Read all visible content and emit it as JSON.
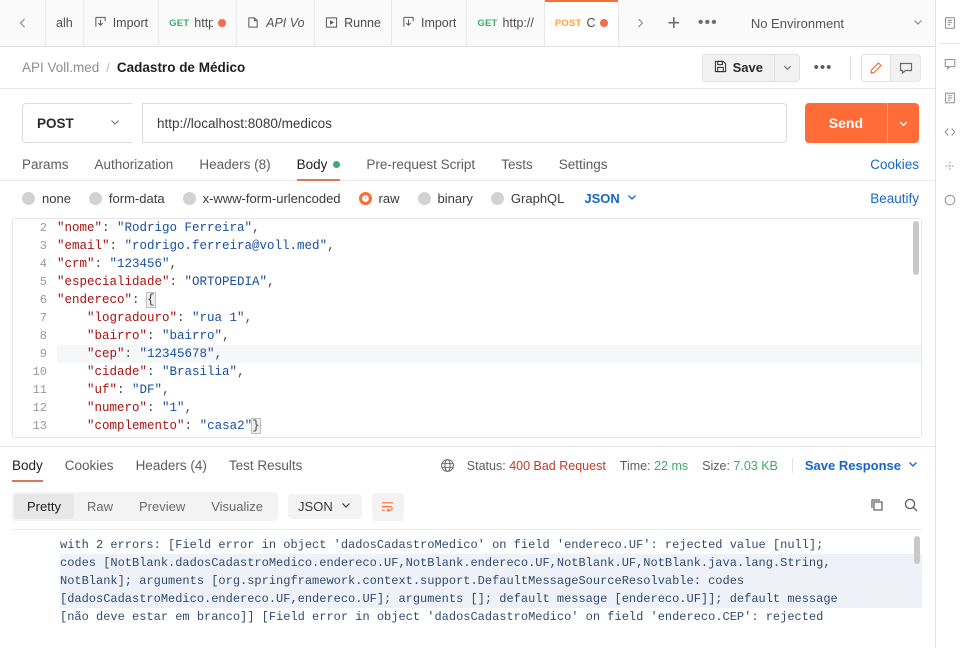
{
  "tabbar": {
    "nav_back": "chevron-left",
    "nav_forward": "chevron-right",
    "add_label": "+",
    "more_label": "•••",
    "environment": "No Environment",
    "tabs": [
      {
        "method": "",
        "label": "alh",
        "icon": "",
        "unsaved": false,
        "active": false,
        "italic": false
      },
      {
        "method": "",
        "label": "Import",
        "icon": "import-icon",
        "unsaved": false,
        "active": false,
        "italic": false
      },
      {
        "method": "GET",
        "label": "http",
        "icon": "",
        "unsaved": true,
        "active": false,
        "italic": false
      },
      {
        "method": "",
        "label": "API Vo",
        "icon": "collection-icon",
        "unsaved": false,
        "active": false,
        "italic": true
      },
      {
        "method": "",
        "label": "Runne",
        "icon": "runner-icon",
        "unsaved": false,
        "active": false,
        "italic": false
      },
      {
        "method": "",
        "label": "Import",
        "icon": "import-icon",
        "unsaved": false,
        "active": false,
        "italic": false
      },
      {
        "method": "GET",
        "label": "http://",
        "icon": "",
        "unsaved": false,
        "active": false,
        "italic": false
      },
      {
        "method": "POST",
        "label": "Ca",
        "icon": "",
        "unsaved": true,
        "active": true,
        "italic": false
      }
    ]
  },
  "breadcrumb": {
    "collection": "API Voll.med",
    "separator": "/",
    "request": "Cadastro de Médico"
  },
  "toolbar": {
    "save_label": "Save",
    "save_caret": "chevron-down",
    "more_label": "•••",
    "edit_icon": "pencil-icon",
    "comment_icon": "comment-icon"
  },
  "request": {
    "method": "POST",
    "url": "http://localhost:8080/medicos",
    "send_label": "Send",
    "tabs": [
      {
        "label": "Params",
        "active": false,
        "dot": false
      },
      {
        "label": "Authorization",
        "active": false,
        "dot": false
      },
      {
        "label": "Headers (8)",
        "active": false,
        "dot": false
      },
      {
        "label": "Body",
        "active": true,
        "dot": true
      },
      {
        "label": "Pre-request Script",
        "active": false,
        "dot": false
      },
      {
        "label": "Tests",
        "active": false,
        "dot": false
      },
      {
        "label": "Settings",
        "active": false,
        "dot": false
      }
    ],
    "cookies_label": "Cookies",
    "body_types": [
      {
        "label": "none",
        "selected": false
      },
      {
        "label": "form-data",
        "selected": false
      },
      {
        "label": "x-www-form-urlencoded",
        "selected": false
      },
      {
        "label": "raw",
        "selected": true
      },
      {
        "label": "binary",
        "selected": false
      },
      {
        "label": "GraphQL",
        "selected": false
      }
    ],
    "format": "JSON",
    "beautify_label": "Beautify"
  },
  "editor": {
    "line_numbers": [
      "2",
      "3",
      "4",
      "5",
      "6",
      "7",
      "8",
      "9",
      "10",
      "11",
      "12",
      "13"
    ],
    "lines": [
      {
        "key": "\"nome\"",
        "value": "\"Rodrigo Ferreira\"",
        "comma": true,
        "indent": 0
      },
      {
        "key": "\"email\"",
        "value": "\"rodrigo.ferreira@voll.med\"",
        "comma": true,
        "indent": 0
      },
      {
        "key": "\"crm\"",
        "value": "\"123456\"",
        "comma": true,
        "indent": 0
      },
      {
        "key": "\"especialidade\"",
        "value": "\"ORTOPEDIA\"",
        "comma": true,
        "indent": 0
      },
      {
        "key": "\"endereco\"",
        "value": "{",
        "comma": false,
        "indent": 0
      },
      {
        "key": "\"logradouro\"",
        "value": "\"rua 1\"",
        "comma": true,
        "indent": 1
      },
      {
        "key": "\"bairro\"",
        "value": "\"bairro\"",
        "comma": true,
        "indent": 1
      },
      {
        "key": "\"cep\"",
        "value": "\"12345678\"",
        "comma": true,
        "indent": 1
      },
      {
        "key": "\"cidade\"",
        "value": "\"Brasilia\"",
        "comma": true,
        "indent": 1
      },
      {
        "key": "\"uf\"",
        "value": "\"DF\"",
        "comma": true,
        "indent": 1
      },
      {
        "key": "\"numero\"",
        "value": "\"1\"",
        "comma": true,
        "indent": 1
      },
      {
        "key": "\"complemento\"",
        "value": "\"casa2\"",
        "comma": false,
        "indent": 1,
        "trailing": "}"
      }
    ]
  },
  "response": {
    "tabs": [
      {
        "label": "Body",
        "active": true
      },
      {
        "label": "Cookies",
        "active": false
      },
      {
        "label": "Headers (4)",
        "active": false
      },
      {
        "label": "Test Results",
        "active": false
      }
    ],
    "globe_icon": "globe-icon",
    "status_label": "Status:",
    "status_value": "400 Bad Request",
    "time_label": "Time:",
    "time_value": "22 ms",
    "size_label": "Size:",
    "size_value": "7.03 KB",
    "save_response_label": "Save Response",
    "views": [
      {
        "label": "Pretty",
        "active": true
      },
      {
        "label": "Raw",
        "active": false
      },
      {
        "label": "Preview",
        "active": false
      },
      {
        "label": "Visualize",
        "active": false
      }
    ],
    "format": "JSON",
    "wrap_icon": "wrap-lines-icon",
    "copy_icon": "copy-icon",
    "search_icon": "search-icon",
    "body_lines": [
      "with 2 errors: [Field error in object 'dadosCadastroMedico' on field 'endereco.UF': rejected value [null];",
      "codes [NotBlank.dadosCadastroMedico.endereco.UF,NotBlank.endereco.UF,NotBlank.UF,NotBlank.java.lang.String,",
      "NotBlank]; arguments [org.springframework.context.support.DefaultMessageSourceResolvable: codes",
      "[dadosCadastroMedico.endereco.UF,endereco.UF]; arguments []; default message [endereco.UF]]; default message",
      "[não deve estar em branco]] [Field error in object 'dadosCadastroMedico' on field 'endereco.CEP': rejected"
    ]
  },
  "right_rail": {
    "icons": [
      "documentation-icon",
      "comment-icon",
      "info-icon",
      "code-icon",
      "mock-icon",
      "monitor-icon"
    ]
  },
  "colors": {
    "accent": "#ff6c37",
    "link": "#1666c8",
    "success": "#3dab6d",
    "error": "#c0392b"
  }
}
